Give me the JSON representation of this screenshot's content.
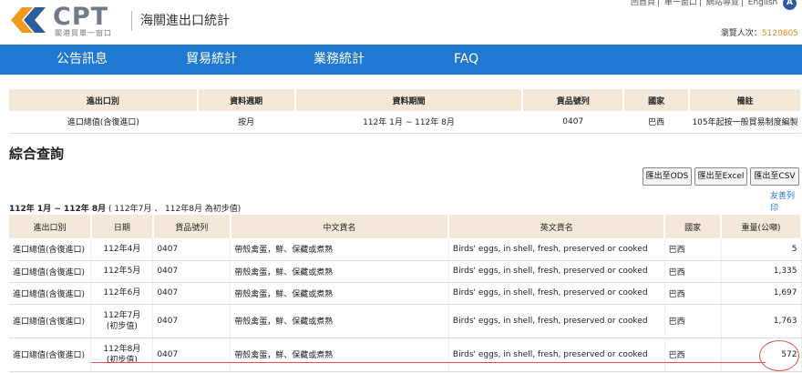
{
  "header": {
    "logo_text": "CPT",
    "logo_sub": "關港貿單一窗口",
    "site_title": "海關進出口統計",
    "top_links": [
      "回首頁",
      "單一窗口",
      "網站導覽",
      "English"
    ],
    "a_badge": "A",
    "visitor_label": "瀏覽人次：",
    "visitor_count": "5120805"
  },
  "nav": {
    "items": [
      "公告訊息",
      "貿易統計",
      "業務統計",
      "FAQ"
    ]
  },
  "criteria": {
    "headers": [
      "進出口別",
      "資料週期",
      "資料期間",
      "貨品號列",
      "國家",
      "備註"
    ],
    "row": [
      "進口總值(含復進口)",
      "按月",
      "112年 1月 ~ 112年 8月",
      "0407",
      "巴西",
      "105年起按一般貿易制度編製"
    ]
  },
  "section_title": "綜合查詢",
  "exports": [
    "匯出至ODS",
    "匯出至Excel",
    "匯出至CSV"
  ],
  "print_link": "友善列印",
  "period": {
    "bold": "112年 1月 ~ 112年 8月",
    "note": " ( 112年7月 、 112年8月 為初步值)"
  },
  "results": {
    "headers": [
      "進出口別",
      "日期",
      "貨品號列",
      "中文貨名",
      "英文貨名",
      "國家",
      "重量(公噸)"
    ],
    "rows": [
      {
        "type": "進口總值(含復進口)",
        "date": "112年4月",
        "date2": "",
        "code": "0407",
        "zh": "帶殼禽蛋，鮮、保藏或煮熟",
        "en": "Birds' eggs, in shell, fresh, preserved or cooked",
        "country": "巴西",
        "weight": "5"
      },
      {
        "type": "進口總值(含復進口)",
        "date": "112年5月",
        "date2": "",
        "code": "0407",
        "zh": "帶殼禽蛋，鮮、保藏或煮熟",
        "en": "Birds' eggs, in shell, fresh, preserved or cooked",
        "country": "巴西",
        "weight": "1,335"
      },
      {
        "type": "進口總值(含復進口)",
        "date": "112年6月",
        "date2": "",
        "code": "0407",
        "zh": "帶殼禽蛋，鮮、保藏或煮熟",
        "en": "Birds' eggs, in shell, fresh, preserved or cooked",
        "country": "巴西",
        "weight": "1,697"
      },
      {
        "type": "進口總值(含復進口)",
        "date": "112年7月",
        "date2": "(初步值)",
        "code": "0407",
        "zh": "帶殼禽蛋，鮮、保藏或煮熟",
        "en": "Birds' eggs, in shell, fresh, preserved or cooked",
        "country": "巴西",
        "weight": "1,763"
      },
      {
        "type": "進口總值(含復進口)",
        "date": "112年8月",
        "date2": "(初步值)",
        "code": "0407",
        "zh": "帶殼禽蛋，鮮、保藏或煮熟",
        "en": "Birds' eggs, in shell, fresh, preserved or cooked",
        "country": "巴西",
        "weight": "572"
      }
    ]
  },
  "colors": {
    "nav_bg": "#1f78d1",
    "table_header_bg": "#f3e8da",
    "visitor_count": "#e08a1e",
    "annotation": "#d9534f"
  }
}
